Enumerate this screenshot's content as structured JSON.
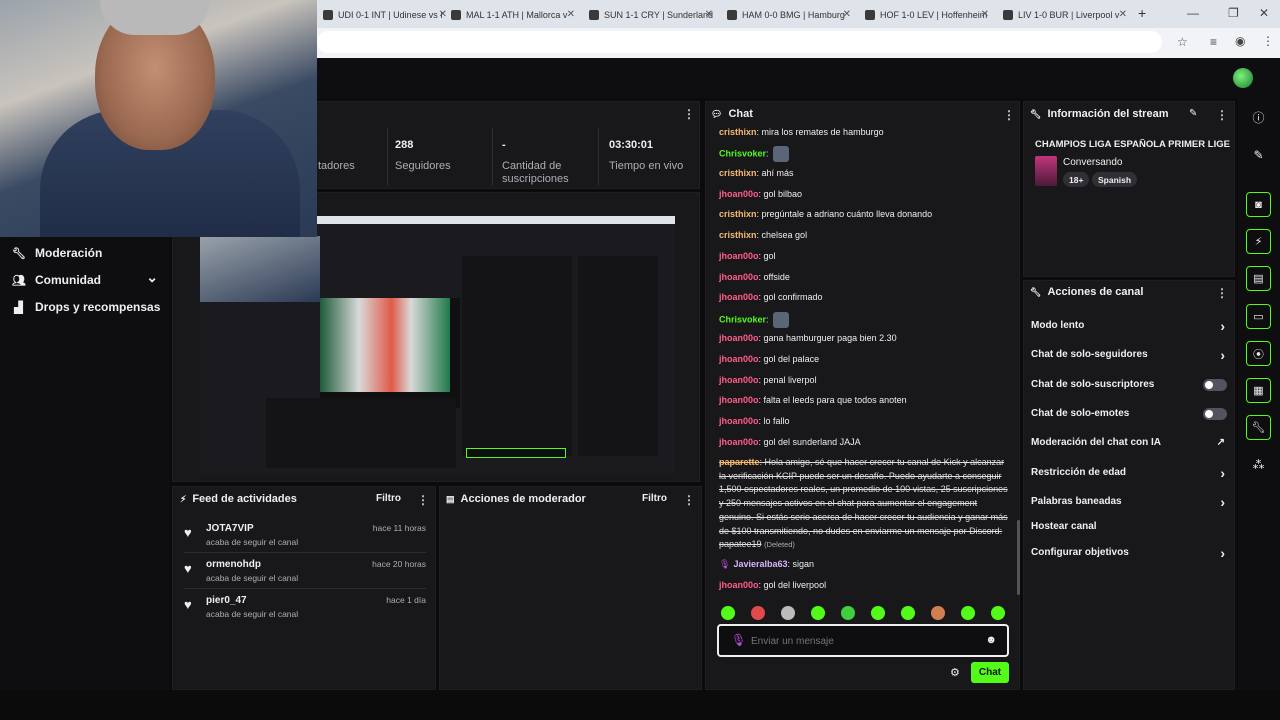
{
  "browser": {
    "tabs": [
      {
        "label": "UDI 0-1 INT | Udinese vs I"
      },
      {
        "label": "MAL 1-1 ATH | Mallorca v"
      },
      {
        "label": "SUN 1-1 CRY | Sunderland"
      },
      {
        "label": "HAM 0-0 BMG | Hamburg"
      },
      {
        "label": "HOF 1-0 LEV | Hoffenheim"
      },
      {
        "label": "LIV 1-0 BUR | Liverpool v"
      }
    ],
    "new_tab": "+"
  },
  "nav": {
    "items": [
      {
        "label": "Moderación",
        "icon": "wrench-icon"
      },
      {
        "label": "Comunidad",
        "icon": "users-icon",
        "chevron": "⌄"
      },
      {
        "label": "Drops y recompensas",
        "icon": "drops-icon"
      }
    ]
  },
  "stats": [
    {
      "value": "",
      "label": "tadores"
    },
    {
      "value": "288",
      "label": "Seguidores"
    },
    {
      "value": "-",
      "label": "Cantidad de suscripciones"
    },
    {
      "value": "03:30:01",
      "label": "Tiempo en vivo"
    }
  ],
  "activity_feed": {
    "title": "Feed de actividades",
    "filter": "Filtro",
    "items": [
      {
        "name": "JOTA7VIP",
        "time": "hace 11 horas",
        "sub": "acaba de seguir el canal"
      },
      {
        "name": "ormenohdp",
        "time": "hace 20 horas",
        "sub": "acaba de seguir el canal"
      },
      {
        "name": "pier0_47",
        "time": "hace 1 día",
        "sub": "acaba de seguir el canal"
      }
    ]
  },
  "mod_actions": {
    "title": "Acciones de moderador",
    "filter": "Filtro"
  },
  "chat": {
    "title": "Chat",
    "messages": [
      {
        "user": "cristhixn",
        "color": "#f5b971",
        "text": "mira los remates de hamburgo"
      },
      {
        "user": "Chrisvoker",
        "color": "#53fc18",
        "text": "",
        "emote": true
      },
      {
        "user": "cristhixn",
        "color": "#f5b971",
        "text": "ahí más"
      },
      {
        "user": "jhoan00o",
        "color": "#ff5c8a",
        "text": "gol bilbao"
      },
      {
        "user": "cristhixn",
        "color": "#f5b971",
        "text": "pregúntale a adriano cuánto lleva donando"
      },
      {
        "user": "cristhixn",
        "color": "#f5b971",
        "text": "chelsea gol"
      },
      {
        "user": "jhoan00o",
        "color": "#ff5c8a",
        "text": "gol"
      },
      {
        "user": "jhoan00o",
        "color": "#ff5c8a",
        "text": "offside"
      },
      {
        "user": "jhoan00o",
        "color": "#ff5c8a",
        "text": "gol confirmado"
      },
      {
        "user": "Chrisvoker",
        "color": "#53fc18",
        "text": "",
        "emote": true
      },
      {
        "user": "jhoan00o",
        "color": "#ff5c8a",
        "text": "gana hamburguer paga bien 2.30"
      },
      {
        "user": "jhoan00o",
        "color": "#ff5c8a",
        "text": "gol del palace"
      },
      {
        "user": "jhoan00o",
        "color": "#ff5c8a",
        "text": "penal liverpol"
      },
      {
        "user": "jhoan00o",
        "color": "#ff5c8a",
        "text": "falta el leeds para que todos anoten"
      },
      {
        "user": "jhoan00o",
        "color": "#ff5c8a",
        "text": "lo fallo"
      },
      {
        "user": "jhoan00o",
        "color": "#ff5c8a",
        "text": "gol del sunderland JAJA"
      }
    ],
    "deleted_message": {
      "user": "paparette",
      "color": "#f5b971",
      "text": "Hola amigo, sé que hacer crecer tu canal de Kick y alcanzar la verificación KCIP puede ser un desafío. Puedo ayudarte a conseguir 1,500 espectadores reales, un promedio de 100 vistas, 25 suscripciones y 250 mensajes activos en el chat para aumentar el engagement genuino. Si estás serio acerca de hacer crecer tu audiencia y ganar más de $100 transmitiendo, no dudes en enviarme un mensaje por Discord: papatee19",
      "tag": "(Deleted)"
    },
    "after": [
      {
        "user": "Javieralba63",
        "color": "#d9b3ff",
        "text": "sigan",
        "badge": true
      },
      {
        "user": "jhoan00o",
        "color": "#ff5c8a",
        "text": "gol del liverpool"
      }
    ],
    "input_placeholder": "Enviar un mensaje",
    "send_label": "Chat"
  },
  "stream_info": {
    "title": "Información del stream",
    "stream_title": "CHAMPIOS LIGA ESPAÑOLA PRIMER LIGE",
    "category": "Conversando",
    "badges": [
      "18+",
      "Spanish"
    ]
  },
  "channel_actions": {
    "title": "Acciones de canal",
    "items": [
      {
        "label": "Modo lento",
        "control": "chevron"
      },
      {
        "label": "Chat de solo-seguidores",
        "control": "chevron"
      },
      {
        "label": "Chat de solo-suscriptores",
        "control": "toggle"
      },
      {
        "label": "Chat de solo-emotes",
        "control": "toggle"
      },
      {
        "label": "Moderación del chat con IA",
        "control": "external"
      },
      {
        "label": "Restricción de edad",
        "control": "chevron"
      },
      {
        "label": "Palabras baneadas",
        "control": "chevron"
      },
      {
        "label": "Hostear canal",
        "control": "none"
      },
      {
        "label": "Configurar objetivos",
        "control": "chevron"
      }
    ]
  },
  "colors": {
    "accent": "#53fc18",
    "panel": "#18181b",
    "background": "#0e0e10"
  }
}
